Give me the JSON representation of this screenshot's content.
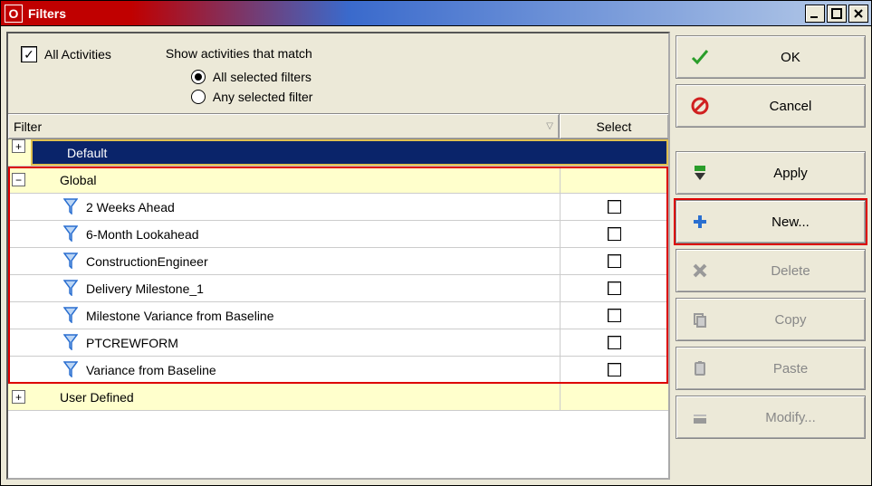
{
  "window": {
    "title": "Filters"
  },
  "controls": {
    "all_activities_label": "All Activities",
    "all_activities_checked": true,
    "match_heading": "Show activities that match",
    "radio_all_label": "All selected filters",
    "radio_all_selected": true,
    "radio_any_label": "Any selected filter",
    "radio_any_selected": false
  },
  "table": {
    "header_filter": "Filter",
    "header_select": "Select"
  },
  "groups": [
    {
      "name": "Default",
      "expanded": false,
      "selected": true,
      "items": []
    },
    {
      "name": "Global",
      "expanded": true,
      "selected": false,
      "highlight": true,
      "items": [
        {
          "name": "2 Weeks Ahead",
          "checked": false
        },
        {
          "name": "6-Month Lookahead",
          "checked": false
        },
        {
          "name": "ConstructionEngineer",
          "checked": false
        },
        {
          "name": "Delivery Milestone_1",
          "checked": false
        },
        {
          "name": "Milestone Variance from Baseline",
          "checked": false
        },
        {
          "name": "PTCREWFORM",
          "checked": false
        },
        {
          "name": "Variance from Baseline",
          "checked": false
        }
      ]
    },
    {
      "name": "User Defined",
      "expanded": false,
      "selected": false,
      "items": []
    }
  ],
  "buttons": {
    "ok": {
      "label": "OK"
    },
    "cancel": {
      "label": "Cancel"
    },
    "apply": {
      "label": "Apply"
    },
    "new": {
      "label": "New...",
      "highlight": true
    },
    "delete": {
      "label": "Delete",
      "disabled": true
    },
    "copy": {
      "label": "Copy",
      "disabled": true
    },
    "paste": {
      "label": "Paste",
      "disabled": true
    },
    "modify": {
      "label": "Modify...",
      "disabled": true
    }
  }
}
